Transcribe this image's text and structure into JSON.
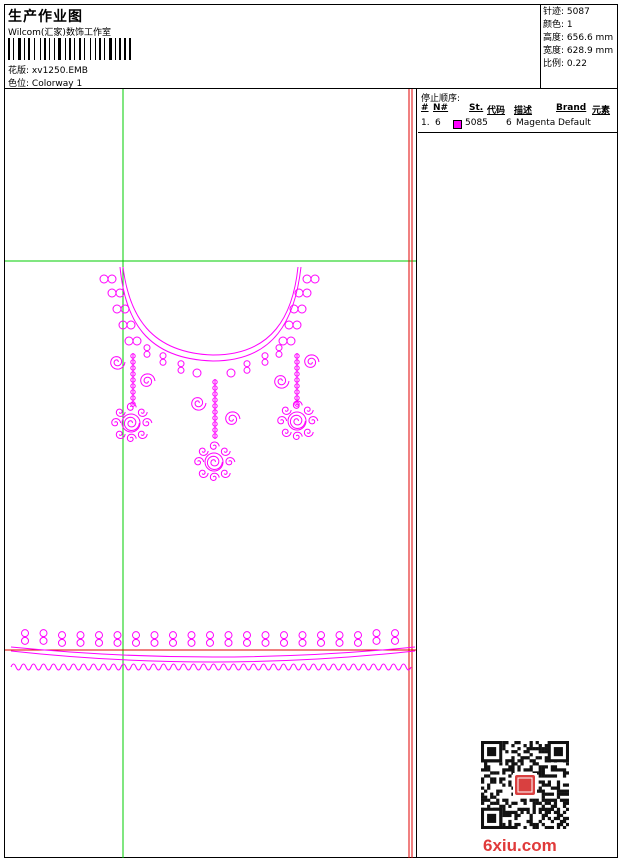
{
  "header": {
    "title": "生产作业图",
    "company": "Wilcom(汇家)数饰工作室",
    "design_label": "花版:",
    "design_value": "xv1250.EMB",
    "color_label": "色位:",
    "color_value": "Colorway 1"
  },
  "stats": {
    "stitches_label": "针迹:",
    "stitches_value": "5087",
    "colors_label": "颜色:",
    "colors_value": "1",
    "height_label": "高度:",
    "height_value": "656.6 mm",
    "width_label": "宽度:",
    "width_value": "628.9 mm",
    "scale_label": "比例:",
    "scale_value": "0.22"
  },
  "stop_sequence": {
    "title": "停止顺序:",
    "headers": [
      "#",
      "N#",
      "St.",
      "代码",
      "描述",
      "Brand",
      "元素"
    ],
    "rows": [
      {
        "num": "1.",
        "needle": "6",
        "stitches": "5085",
        "code": "6",
        "description": "Magenta",
        "brand": "Default",
        "color": "#ff00ff"
      }
    ]
  },
  "watermark": {
    "text": "6xiu.com"
  },
  "colors": {
    "thread": "#ff00ff",
    "guide_green": "#00cc00",
    "guide_red": "#e00000"
  }
}
